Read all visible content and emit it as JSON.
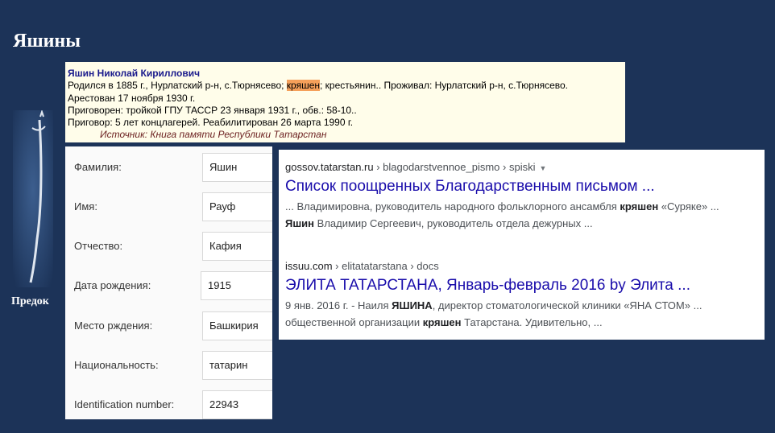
{
  "page_title": "Яшины",
  "ancestor": {
    "caption": "Предок",
    "image_icon": "saber-icon"
  },
  "memory_card": {
    "name": "Яшин Николай Кириллович",
    "born_prefix": "Родился в 1885 г., Нурлатский р-н, с.Тюрнясево; ",
    "born_highlight": "кряшен",
    "born_suffix": "; крестьянин.. Проживал: Нурлатский р-н, с.Тюрнясево.",
    "arrested": "Арестован 17 ноября 1930 г.",
    "sentenced_by": "Приговорен: тройкой ГПУ ТАССР 23 января 1931 г., обв.: 58-10..",
    "sentence": "Приговор: 5 лет концлагерей. Реабилитирован 26 марта 1990 г.",
    "source": "Источник: Книга памяти Республики Татарстан"
  },
  "form": {
    "fields": [
      {
        "label": "Фамилия:",
        "value": "Яшин"
      },
      {
        "label": "Имя:",
        "value": "Рауф"
      },
      {
        "label": "Отчество:",
        "value": "Кафия"
      },
      {
        "label": "Дата рождения:",
        "value": "1915"
      },
      {
        "label": "Место рждения:",
        "value": "Башкирия"
      },
      {
        "label": "Национальность:",
        "value": "татарин"
      },
      {
        "label": "Identification number:",
        "value": "22943"
      }
    ]
  },
  "search_results": [
    {
      "domain": "gossov.tatarstan.ru",
      "path": " › blagodarstvennoe_pismo › spiski",
      "title": "Список поощренных Благодарственным письмом ...",
      "line1_a": "... Владимировна, руководитель народного фольклорного ансамбля ",
      "line1_b": "кряшен",
      "line1_c": " «Суряке» ...",
      "line2_a": "Яшин",
      "line2_b": " Владимир Сергеевич, руководитель отдела дежурных ..."
    },
    {
      "domain": "issuu.com",
      "path": " › elitatatarstana › docs",
      "title": "ЭЛИТА ТАТАРСТАНА, Январь-февраль 2016 by Элита ...",
      "line1_a": "9 янв. 2016 г. - Наиля ",
      "line1_b": "ЯШИНА",
      "line1_c": ", директор стоматологической клиники «ЯНА СТОМ» ...",
      "line2_a": "общественной организации ",
      "line2_b": "кряшен",
      "line2_c": " Татарстана. Удивительно, ..."
    }
  ]
}
